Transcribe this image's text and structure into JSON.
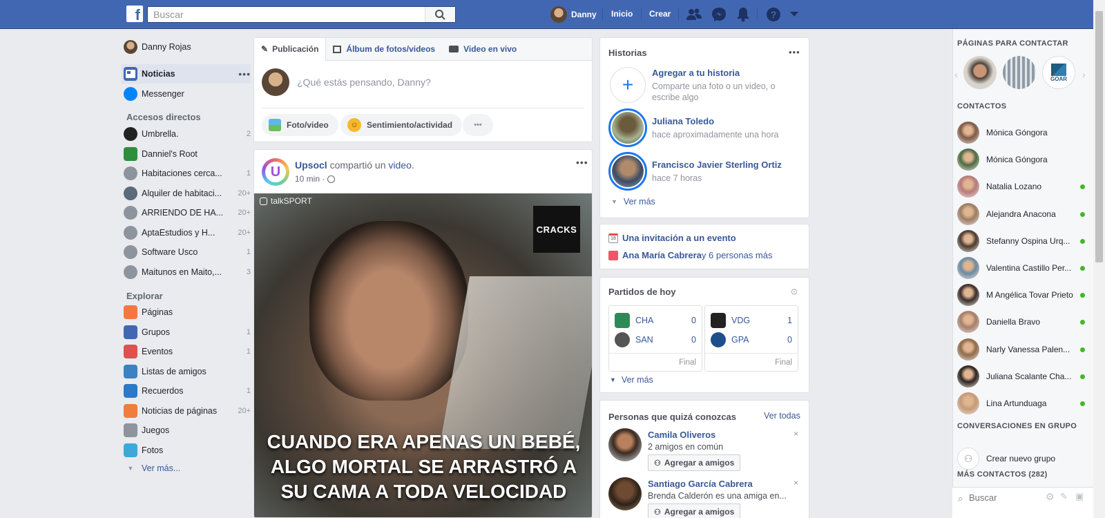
{
  "topbar": {
    "logo": "f",
    "search_placeholder": "Buscar",
    "user_name": "Danny",
    "home": "Inicio",
    "create": "Crear"
  },
  "left_nav": {
    "profile_name": "Danny Rojas",
    "main": [
      {
        "label": "Noticias",
        "icon": "news-feed-icon"
      },
      {
        "label": "Messenger",
        "icon": "messenger-icon"
      }
    ],
    "shortcuts_header": "Accesos directos",
    "shortcuts": [
      {
        "label": "Umbrella.",
        "count": "2"
      },
      {
        "label": "Danniel's Root",
        "count": ""
      },
      {
        "label": "Habitaciones cerca...",
        "count": "1"
      },
      {
        "label": "Alquiler de habitaci...",
        "count": "20+"
      },
      {
        "label": "ARRIENDO DE HA...",
        "count": "20+"
      },
      {
        "label": "AptaEstudios y H...",
        "count": "20+"
      },
      {
        "label": "Software Usco",
        "count": "1"
      },
      {
        "label": "Maitunos en Maito,...",
        "count": "3"
      }
    ],
    "explore_header": "Explorar",
    "explore": [
      {
        "label": "Páginas",
        "count": ""
      },
      {
        "label": "Grupos",
        "count": "1"
      },
      {
        "label": "Eventos",
        "count": "1"
      },
      {
        "label": "Listas de amigos",
        "count": ""
      },
      {
        "label": "Recuerdos",
        "count": "1"
      },
      {
        "label": "Noticias de páginas",
        "count": "20+"
      },
      {
        "label": "Juegos",
        "count": ""
      },
      {
        "label": "Fotos",
        "count": ""
      }
    ],
    "see_more": "Ver más..."
  },
  "composer": {
    "tabs": [
      "Publicación",
      "Álbum de fotos/videos",
      "Video en vivo"
    ],
    "placeholder": "¿Qué estás pensando, Danny?",
    "photo_btn": "Foto/video",
    "feeling_btn": "Sentimiento/actividad",
    "more_btn": "•••"
  },
  "post": {
    "author": "Upsocl",
    "action": " compartió un ",
    "object": "video.",
    "time": "10 min ·",
    "watermark": "talkSPORT",
    "badge": "CRACKS",
    "caption_lines": [
      "CUANDO ERA APENAS UN BEBÉ,",
      "ALGO MORTAL SE ARRASTRÓ A",
      "SU CAMA A TODA VELOCIDAD"
    ]
  },
  "stories": {
    "title": "Historias",
    "add_title": "Agregar a tu historia",
    "add_sub": "Comparte una foto o un video, o escribe algo",
    "items": [
      {
        "name": "Juliana Toledo",
        "time": "hace aproximadamente una hora"
      },
      {
        "name": "Francisco Javier Sterling Ortiz",
        "time": "hace 7 horas"
      }
    ],
    "see_more": "Ver más"
  },
  "events": {
    "invite": "Una invitación a un evento",
    "bday_name": "Ana María Cabrera",
    "bday_rest": " y 6 personas más"
  },
  "matches": {
    "title": "Partidos de hoy",
    "games": [
      {
        "home": "CHA",
        "home_score": "0",
        "away": "SAN",
        "away_score": "0",
        "status": "Final"
      },
      {
        "home": "VDG",
        "home_score": "1",
        "away": "GPA",
        "away_score": "0",
        "status": "Final"
      }
    ],
    "see_more": "Ver más"
  },
  "pymk": {
    "title": "Personas que quizá conozcas",
    "see_all": "Ver todas",
    "people": [
      {
        "name": "Camila Oliveros",
        "sub": "2 amigos en común",
        "btn": "Agregar a amigos"
      },
      {
        "name": "Santiago García Cabrera",
        "sub": "Brenda Calderón es una amiga en...",
        "btn": "Agregar a amigos"
      }
    ]
  },
  "right": {
    "pages_header": "PÁGINAS PARA CONTACTAR",
    "page_logo_text": "GOAR",
    "contacts_header": "CONTACTOS",
    "contacts": [
      {
        "name": "Mónica Góngora",
        "online": false
      },
      {
        "name": "Mónica Góngora",
        "online": false
      },
      {
        "name": "Natalia Lozano",
        "online": true
      },
      {
        "name": "Alejandra Anacona",
        "online": true
      },
      {
        "name": "Stefanny Ospina Urq...",
        "online": true
      },
      {
        "name": "Valentina Castillo Per...",
        "online": true
      },
      {
        "name": "M Angélica Tovar Prieto",
        "online": true
      },
      {
        "name": "Daniella Bravo",
        "online": true
      },
      {
        "name": "Narly Vanessa Palen...",
        "online": true
      },
      {
        "name": "Juliana Scalante Cha...",
        "online": true
      },
      {
        "name": "Lina Artunduaga",
        "online": true
      }
    ],
    "group_header": "CONVERSACIONES EN GRUPO",
    "create_group": "Crear nuevo grupo",
    "more_contacts": "MÁS CONTACTOS (282)",
    "search_placeholder": "Buscar"
  }
}
